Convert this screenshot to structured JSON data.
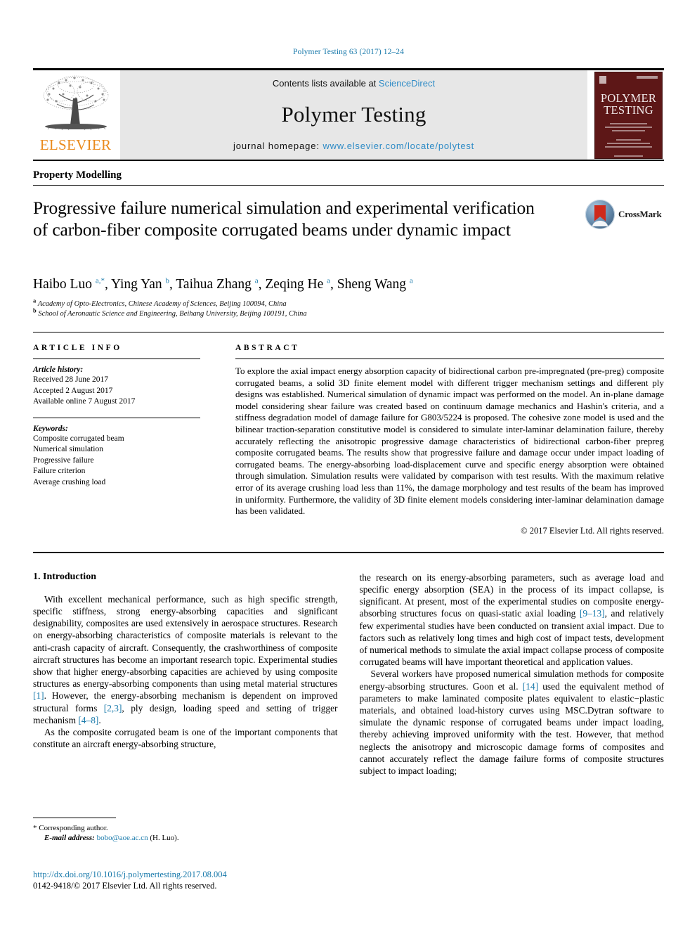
{
  "running_head": "Polymer Testing 63 (2017) 12–24",
  "masthead": {
    "publisher_name": "ELSEVIER",
    "publisher_logo_icon": "elsevier-tree-icon",
    "contents_prefix": "Contents lists available at ",
    "contents_link": "ScienceDirect",
    "journal_name": "Polymer Testing",
    "homepage_prefix": "journal homepage: ",
    "homepage_url": "www.elsevier.com/locate/polytest",
    "cover": {
      "title_line1": "POLYMER",
      "title_line2": "TESTING"
    }
  },
  "section_label": "Property Modelling",
  "article": {
    "title": "Progressive failure numerical simulation and experimental verification of carbon-fiber composite corrugated beams under dynamic impact",
    "crossmark_label": "CrossMark",
    "authors_html": "Haibo Luo <sup>a,*</sup>, Ying Yan <sup>b</sup>, Taihua Zhang <sup>a</sup>, Zeqing He <sup>a</sup>, Sheng Wang <sup>a</sup>",
    "affiliations": [
      {
        "marker": "a",
        "text": "Academy of Opto-Electronics, Chinese Academy of Sciences, Beijing 100094, China"
      },
      {
        "marker": "b",
        "text": "School of Aeronautic Science and Engineering, Beihang University, Beijing 100191, China"
      }
    ]
  },
  "article_info": {
    "heading": "ARTICLE INFO",
    "history_label": "Article history:",
    "history": [
      "Received 28 June 2017",
      "Accepted 2 August 2017",
      "Available online 7 August 2017"
    ],
    "keywords_label": "Keywords:",
    "keywords": [
      "Composite corrugated beam",
      "Numerical simulation",
      "Progressive failure",
      "Failure criterion",
      "Average crushing load"
    ]
  },
  "abstract": {
    "heading": "ABSTRACT",
    "text": "To explore the axial impact energy absorption capacity of bidirectional carbon pre-impregnated (pre-preg) composite corrugated beams, a solid 3D finite element model with different trigger mechanism settings and different ply designs was established. Numerical simulation of dynamic impact was performed on the model. An in-plane damage model considering shear failure was created based on continuum damage mechanics and Hashin's criteria, and a stiffness degradation model of damage failure for G803/5224 is proposed. The cohesive zone model is used and the bilinear traction-separation constitutive model is considered to simulate inter-laminar delamination failure, thereby accurately reflecting the anisotropic progressive damage characteristics of bidirectional carbon-fiber prepreg composite corrugated beams. The results show that progressive failure and damage occur under impact loading of corrugated beams. The energy-absorbing load-displacement curve and specific energy absorption were obtained through simulation. Simulation results were validated by comparison with test results. With the maximum relative error of its average crushing load less than 11%, the damage morphology and test results of the beam has improved in uniformity. Furthermore, the validity of 3D finite element models considering inter-laminar delamination damage has been validated.",
    "copyright": "© 2017 Elsevier Ltd. All rights reserved."
  },
  "body": {
    "intro_heading": "1. Introduction",
    "left_p1": "With excellent mechanical performance, such as high specific strength, specific stiffness, strong energy-absorbing capacities and significant designability, composites are used extensively in aerospace structures. Research on energy-absorbing characteristics of composite materials is relevant to the anti-crash capacity of aircraft. Consequently, the crashworthiness of composite aircraft structures has become an important research topic. Experimental studies show that higher energy-absorbing capacities are achieved by using composite structures as energy-absorbing components than using metal material structures ",
    "left_ref1": "[1]",
    "left_p1b": ". However, the energy-absorbing mechanism is dependent on improved structural forms ",
    "left_ref2": "[2,3]",
    "left_p1c": ", ply design, loading speed and setting of trigger mechanism ",
    "left_ref3": "[4–8]",
    "left_p1d": ".",
    "left_p2": "As the composite corrugated beam is one of the important components that constitute an aircraft energy-absorbing structure,",
    "right_p1a": "the research on its energy-absorbing parameters, such as average load and specific energy absorption (SEA) in the process of its impact collapse, is significant. At present, most of the experimental studies on composite energy-absorbing structures focus on quasi-static axial loading ",
    "right_ref1": "[9–13]",
    "right_p1b": ", and relatively few experimental studies have been conducted on transient axial impact. Due to factors such as relatively long times and high cost of impact tests, development of numerical methods to simulate the axial impact collapse process of composite corrugated beams will have important theoretical and application values.",
    "right_p2a": "Several workers have proposed numerical simulation methods for composite energy-absorbing structures. Goon et al. ",
    "right_ref2": "[14]",
    "right_p2b": " used the equivalent method of parameters to make laminated composite plates equivalent to elastic−plastic materials, and obtained load-history curves using MSC.Dytran software to simulate the dynamic response of corrugated beams under impact loading, thereby achieving improved uniformity with the test. However, that method neglects the anisotropy and microscopic damage forms of composites and cannot accurately reflect the damage failure forms of composite structures subject to impact loading;"
  },
  "footnote": {
    "corresponding_marker": "*",
    "corresponding_text": "Corresponding author.",
    "email_label": "E-mail address:",
    "email": "bobo@aoe.ac.cn",
    "email_suffix": "(H. Luo)."
  },
  "footer": {
    "doi": "http://dx.doi.org/10.1016/j.polymertesting.2017.08.004",
    "copyright": "0142-9418/© 2017 Elsevier Ltd. All rights reserved."
  },
  "colors": {
    "link": "#1a7aab",
    "sciencedirect": "#2e8bc6",
    "elsevier_orange": "#ea8b1e",
    "cover_maroon": "#5d1717",
    "crossmark_red": "#cf2a1c"
  }
}
